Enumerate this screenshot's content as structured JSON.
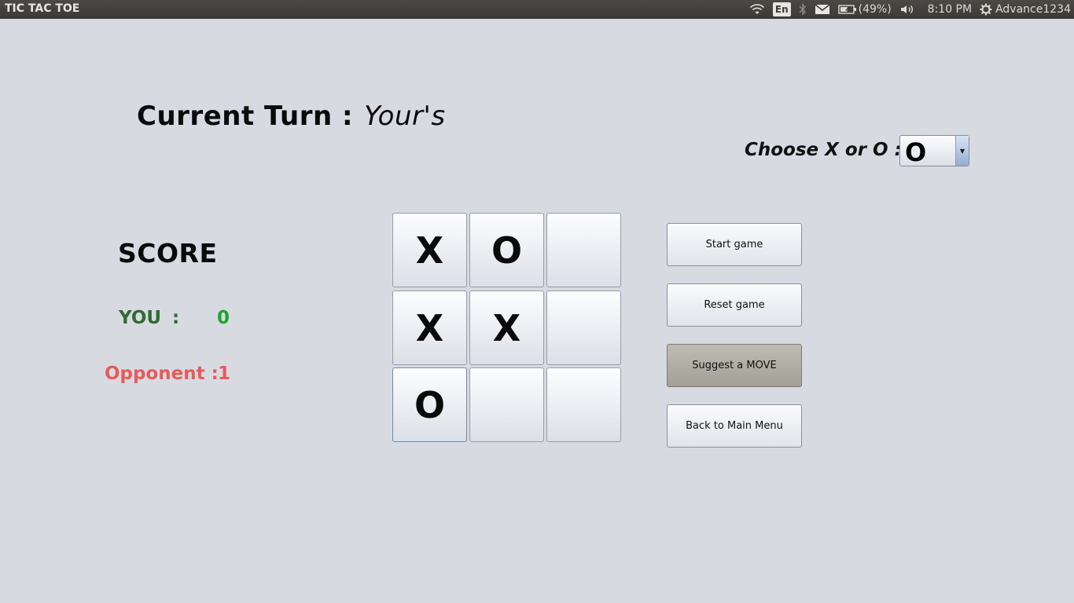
{
  "topbar": {
    "title": "TIC TAC TOE",
    "language": "En",
    "battery": "(49%)",
    "time": "8:10 PM",
    "user": "Advance1234"
  },
  "turn": {
    "label": "Current Turn :",
    "value": "Your's"
  },
  "choose": {
    "label": "Choose X or O :",
    "selected": "O"
  },
  "score": {
    "title": "SCORE",
    "you_label": "YOU",
    "you_colon": ":",
    "you_value": "0",
    "opponent_label": "Opponent :",
    "opponent_value": "1"
  },
  "board": {
    "cells": [
      "X",
      "O",
      "",
      "X",
      "X",
      "",
      "O",
      "",
      ""
    ]
  },
  "buttons": {
    "start": "Start game",
    "reset": "Reset game",
    "suggest": "Suggest a MOVE",
    "back": "Back to Main Menu"
  },
  "colors": {
    "you": "#2f6b32",
    "you_score": "#1fa52a",
    "opponent": "#e85a5a",
    "background": "#d8dae2"
  }
}
